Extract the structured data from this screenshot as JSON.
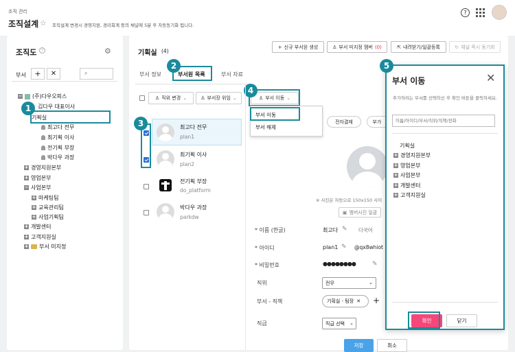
{
  "header": {
    "breadcrumb": "조직 관리",
    "title": "조직설계",
    "description": "조직설계 변경시 경영지원, 경리회계 등의 채널에 5분 후 자동동기화 됩니다."
  },
  "sidebar": {
    "title": "조직도",
    "tab_label": "부서",
    "tree": [
      "(주)다우오피스",
      "김다우 대표이사",
      "기획실",
      "최고다 전무",
      "최기획 이사",
      "전기획 부장",
      "박다우 과장",
      "경영지원본부",
      "영업본부",
      "사업본부",
      "마케팅팀",
      "교육관리팀",
      "사업기획팀",
      "개발센터",
      "고객지원실",
      "부서 미지정"
    ]
  },
  "main": {
    "title": "기획실",
    "count": "(4)",
    "toolbar": {
      "new_member": "신규 부서원 생성",
      "unassigned": "부서 미지정 멤버",
      "unassigned_count": "(0)",
      "download": "내려받기/일괄등록",
      "sync": "채널 즉시 동기화"
    },
    "tabs": [
      "부서 정보",
      "부서원 목록",
      "부서 자료"
    ],
    "list_toolbar": {
      "change_title": "직위 변경",
      "delegate": "부서장 위임",
      "move": "부서 이동"
    },
    "move_menu": [
      "부서 이동",
      "부서 해제"
    ],
    "members": [
      {
        "name": "최고다 전무",
        "id": "plan1"
      },
      {
        "name": "최기획 이사",
        "id": "plan2"
      },
      {
        "name": "전기획 부장",
        "id": "do_platform"
      },
      {
        "name": "박다우 과장",
        "id": "parkdw"
      }
    ],
    "detail": {
      "chip1": "전자결재",
      "chip2": "부가",
      "photo_hint": "※ 사진은 자동으로 150x150 사이",
      "photo_btn": "멤버사진 일괄",
      "name_label": "* 이름 (한글)",
      "name_value": "최고다",
      "multi_lang": "다국어",
      "id_label": "* 아이디",
      "id_value": "plan1",
      "email_value": "@qx8whiot",
      "pw_label": "* 비밀번호",
      "pw_value": "●●●●●●●●",
      "position_label": "직위",
      "position_value": "전무",
      "dept_label": "부서 - 직책",
      "dept_value": "기획실 - 팀장",
      "grade_label": "직급",
      "grade_value": "직급 선택",
      "save": "저장",
      "cancel": "취소"
    }
  },
  "modal": {
    "title": "부서 이동",
    "desc": "추가하려는 부서를 선택하신 후 확인 버튼을 클릭하세요.",
    "search_placeholder": "이름/아이디/부서/직위/직책/전화",
    "tree": [
      "기획실",
      "경영지원본부",
      "영업본부",
      "사업본부",
      "개발센터",
      "고객지원실"
    ],
    "confirm": "확인",
    "close": "닫기"
  },
  "callouts": [
    "1",
    "2",
    "3",
    "4",
    "5"
  ],
  "colors": {
    "teal": "#1a8a9c",
    "primary": "#f5477a"
  }
}
